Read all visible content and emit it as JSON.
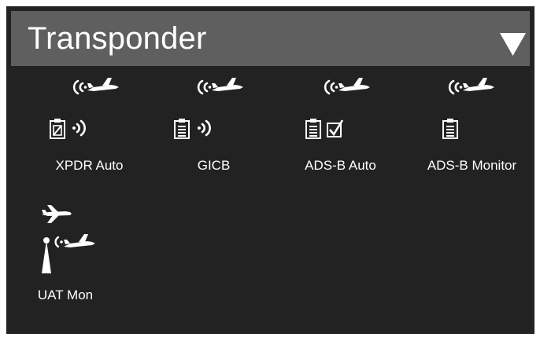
{
  "header": {
    "title": "Transponder",
    "dropdown_icon": "triangle-down-icon"
  },
  "tiles": [
    {
      "label": "XPDR Auto",
      "icons": [
        "aircraft-signal-icon",
        "clipboard-edit-icon",
        "broadcast-icon"
      ]
    },
    {
      "label": "GICB",
      "icons": [
        "aircraft-signal-icon",
        "clipboard-icon",
        "broadcast-icon"
      ]
    },
    {
      "label": "ADS-B Auto",
      "icons": [
        "aircraft-signal-icon",
        "clipboard-icon",
        "checkbox-checked-icon"
      ]
    },
    {
      "label": "ADS-B Monitor",
      "icons": [
        "aircraft-signal-icon",
        "clipboard-icon"
      ]
    },
    {
      "label": "UAT Mon",
      "icons": [
        "aircraft-icon",
        "antenna-tower-icon",
        "aircraft-signal-icon"
      ]
    }
  ],
  "colors": {
    "background": "#222222",
    "header": "#5f5f5f",
    "text": "#ffffff"
  }
}
